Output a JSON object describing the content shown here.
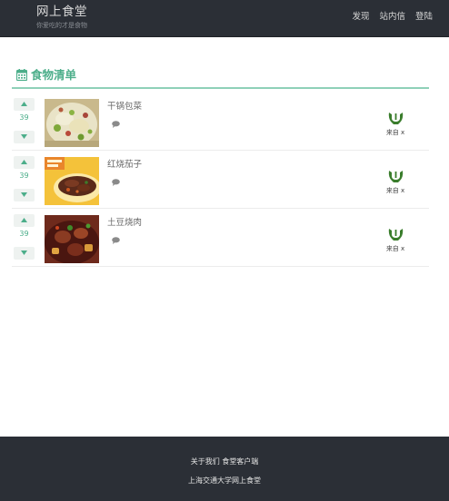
{
  "header": {
    "site_title": "网上食堂",
    "tagline": "你爱吃的才是食物",
    "nav": [
      {
        "label": "发现"
      },
      {
        "label": "站内信"
      },
      {
        "label": "登陆"
      }
    ]
  },
  "section": {
    "icon": "calendar-icon",
    "title": "食物清单"
  },
  "foods": [
    {
      "name": "干锅包菜",
      "votes": "39",
      "source_text": "来自 x",
      "source_icon": "canteen-logo-icon"
    },
    {
      "name": "红烧茄子",
      "votes": "39",
      "source_text": "来自 x",
      "source_icon": "canteen-logo-icon"
    },
    {
      "name": "土豆烧肉",
      "votes": "39",
      "source_text": "来自 x",
      "source_icon": "canteen-logo-icon"
    }
  ],
  "footer": {
    "about_label": "关于我们",
    "client_label": "食堂客户端",
    "copyright": "上海交通大学网上食堂"
  },
  "colors": {
    "nav_bg": "#2b2f36",
    "accent": "#4cae8a",
    "logo_green": "#3a7d2c"
  }
}
